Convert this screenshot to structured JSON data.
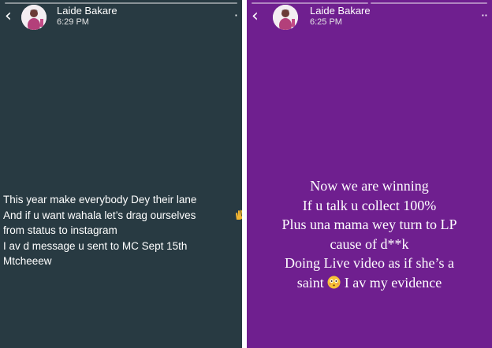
{
  "left_story": {
    "user_name": "Laide Bakare",
    "time": "6:29 PM",
    "lines": [
      "This year make everybody Dey their lane",
      "And if u want wahala let’s drag ourselves",
      "from status to instagram",
      "I av d message u sent to MC Sept 15th",
      "Mtcheeew"
    ],
    "background_color": "#283a42"
  },
  "right_story": {
    "user_name": "Laide Bakare",
    "time": "6:25 PM",
    "lines": [
      "Now we are winning",
      "If u talk u collect 100%",
      "Plus una mama wey turn to LP",
      "cause of d**k",
      "Doing Live video as if she’s a"
    ],
    "last_line_start": "saint ",
    "last_line_end": " I av my evidence",
    "background_color": "#6f1f8f"
  },
  "icons": {
    "back": "chevron-left-icon",
    "menu": "more-options-icon",
    "flushed_face": "flushed-face-emoji",
    "hands": "raised-hands-emoji"
  }
}
